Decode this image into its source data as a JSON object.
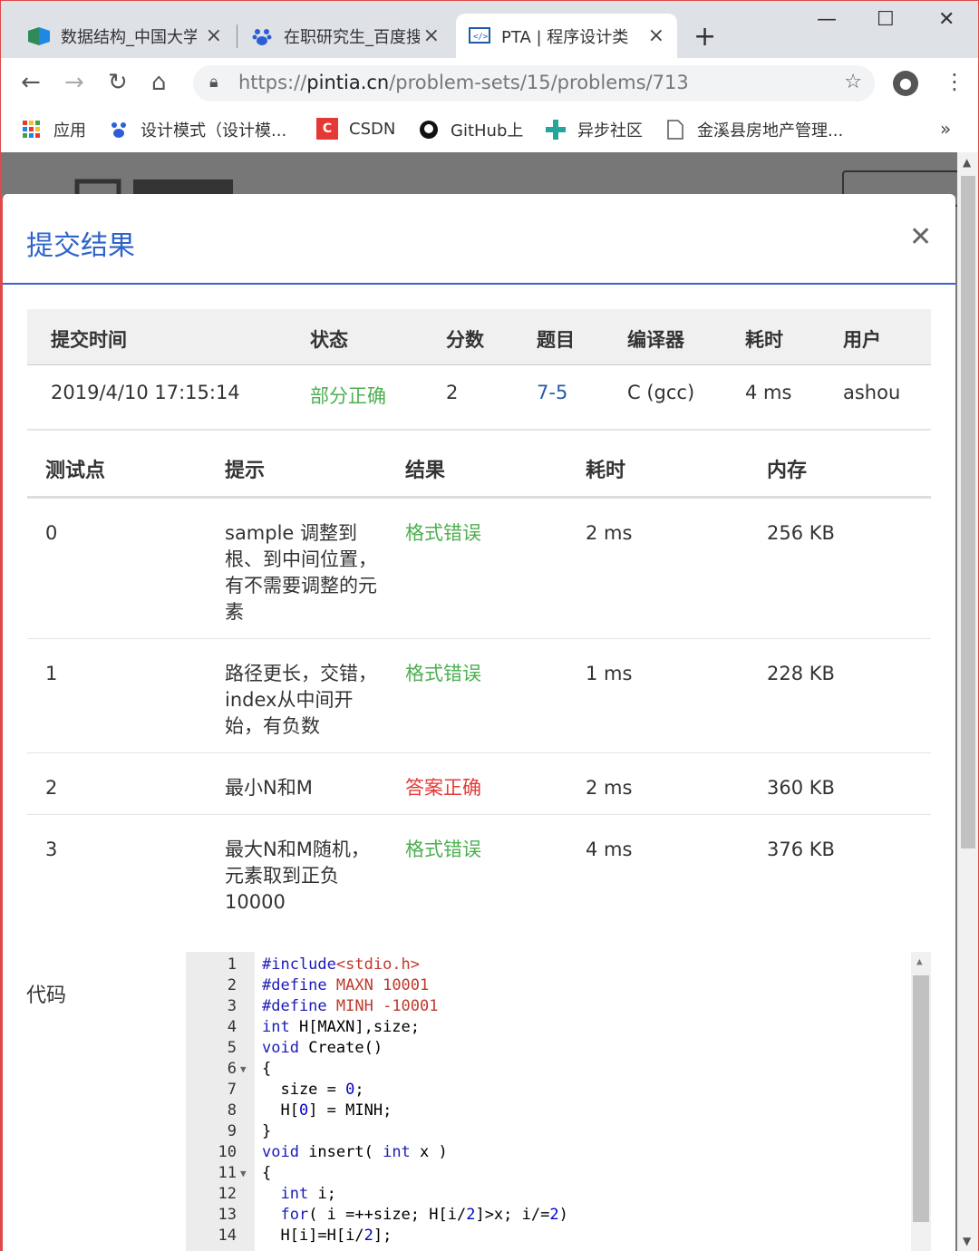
{
  "browser": {
    "tabs": [
      {
        "title": "数据结构_中国大学",
        "icon": "mooc-icon"
      },
      {
        "title": "在职研究生_百度搜",
        "icon": "baidu-icon"
      },
      {
        "title": "PTA | 程序设计类",
        "icon": "pta-icon"
      }
    ],
    "url_scheme": "https://",
    "url_host": "pintia.cn",
    "url_path": "/problem-sets/15/problems/713",
    "bookmarks": [
      "应用",
      "设计模式（设计模...",
      "CSDN",
      "GitHub上",
      "异步社区",
      "金溪县房地产管理..."
    ]
  },
  "modal": {
    "title": "提交结果",
    "summary_headers": [
      "提交时间",
      "状态",
      "分数",
      "题目",
      "编译器",
      "耗时",
      "用户"
    ],
    "summary": {
      "time": "2019/4/10 17:15:14",
      "status": "部分正确",
      "score": "2",
      "problem": "7-5",
      "compiler": "C (gcc)",
      "duration": "4 ms",
      "user": "ashou"
    },
    "test_headers": [
      "测试点",
      "提示",
      "结果",
      "耗时",
      "内存"
    ],
    "tests": [
      {
        "id": "0",
        "hint": "sample 调整到根、到中间位置，有不需要调整的元素",
        "result": "格式错误",
        "time": "2 ms",
        "memory": "256 KB"
      },
      {
        "id": "1",
        "hint": "路径更长，交错，index从中间开始，有负数",
        "result": "格式错误",
        "time": "1 ms",
        "memory": "228 KB"
      },
      {
        "id": "2",
        "hint": "最小N和M",
        "result": "答案正确",
        "time": "2 ms",
        "memory": "360 KB"
      },
      {
        "id": "3",
        "hint": "最大N和M随机，元素取到正负10000",
        "result": "格式错误",
        "time": "4 ms",
        "memory": "376 KB"
      }
    ],
    "code_label": "代码",
    "code_lines": [
      "#include<stdio.h>",
      "#define MAXN 10001",
      "#define MINH -10001",
      "int H[MAXN],size;",
      "void Create()",
      "{",
      "  size = 0;",
      "  H[0] = MINH;",
      "}",
      "void insert( int x )",
      "{",
      "  int i;",
      "  for( i =++size; H[i/2]>x; i/=2)",
      "  H[i]=H[i/2];"
    ],
    "colors": {
      "accent": "#2e64c8",
      "ok": "#4caf50",
      "err": "#e53935"
    }
  }
}
